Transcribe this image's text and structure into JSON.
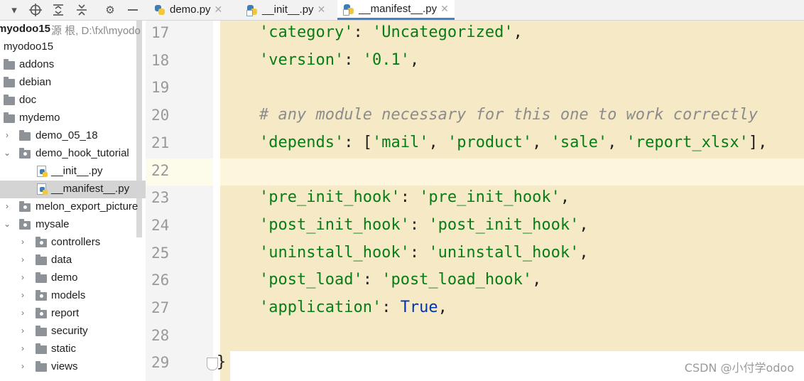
{
  "toolbar": {
    "icons": [
      "chevron-down-icon",
      "crosshair-icon",
      "expand-all-icon",
      "collapse-all-icon",
      "gear-icon",
      "minimize-icon"
    ]
  },
  "tabs": [
    {
      "label": "demo.py",
      "active": false
    },
    {
      "label": "__init__.py",
      "active": false
    },
    {
      "label": "__manifest__.py",
      "active": true
    }
  ],
  "tree": {
    "root_label": "myodoo15",
    "root_hint": "源 根, D:\\fxl\\myodo",
    "items": [
      {
        "label": "myodoo15",
        "type": "text",
        "arrow": ""
      },
      {
        "label": "addons",
        "type": "folder",
        "arrow": ""
      },
      {
        "label": "debian",
        "type": "folder",
        "arrow": ""
      },
      {
        "label": "doc",
        "type": "folder",
        "arrow": ""
      },
      {
        "label": "mydemo",
        "type": "folder",
        "arrow": ""
      },
      {
        "label": "demo_05_18",
        "type": "folder",
        "arrow": ">"
      },
      {
        "label": "demo_hook_tutorial",
        "type": "package",
        "arrow": "v"
      },
      {
        "label": "__init__.py",
        "type": "pyfile",
        "arrow": ""
      },
      {
        "label": "__manifest__.py",
        "type": "pyfile",
        "arrow": "",
        "selected": true
      },
      {
        "label": "melon_export_picture",
        "type": "package",
        "arrow": ">"
      },
      {
        "label": "mysale",
        "type": "package",
        "arrow": "v"
      },
      {
        "label": "controllers",
        "type": "package",
        "arrow": ">"
      },
      {
        "label": "data",
        "type": "folder",
        "arrow": ">"
      },
      {
        "label": "demo",
        "type": "folder",
        "arrow": ">"
      },
      {
        "label": "models",
        "type": "package",
        "arrow": ">"
      },
      {
        "label": "report",
        "type": "package",
        "arrow": ">"
      },
      {
        "label": "security",
        "type": "folder",
        "arrow": ">"
      },
      {
        "label": "static",
        "type": "folder",
        "arrow": ">"
      },
      {
        "label": "views",
        "type": "folder",
        "arrow": ">"
      }
    ]
  },
  "editor": {
    "lines": [
      {
        "n": "17",
        "tokens": [
          {
            "t": "'category'",
            "c": "str"
          },
          {
            "t": ": ",
            "c": ""
          },
          {
            "t": "'Uncategorized'",
            "c": "str"
          },
          {
            "t": ",",
            "c": ""
          }
        ]
      },
      {
        "n": "18",
        "tokens": [
          {
            "t": "'version'",
            "c": "str"
          },
          {
            "t": ": ",
            "c": ""
          },
          {
            "t": "'0.1'",
            "c": "str"
          },
          {
            "t": ",",
            "c": ""
          }
        ]
      },
      {
        "n": "19",
        "tokens": []
      },
      {
        "n": "20",
        "tokens": [
          {
            "t": "# any module necessary for this one to work correctly",
            "c": "com"
          }
        ]
      },
      {
        "n": "21",
        "tokens": [
          {
            "t": "'depends'",
            "c": "str"
          },
          {
            "t": ": [",
            "c": ""
          },
          {
            "t": "'mail'",
            "c": "str"
          },
          {
            "t": ", ",
            "c": ""
          },
          {
            "t": "'product'",
            "c": "str"
          },
          {
            "t": ", ",
            "c": ""
          },
          {
            "t": "'sale'",
            "c": "str"
          },
          {
            "t": ", ",
            "c": ""
          },
          {
            "t": "'report_xlsx'",
            "c": "str"
          },
          {
            "t": "],",
            "c": ""
          }
        ]
      },
      {
        "n": "22",
        "tokens": []
      },
      {
        "n": "23",
        "tokens": [
          {
            "t": "'pre_init_hook'",
            "c": "str"
          },
          {
            "t": ": ",
            "c": ""
          },
          {
            "t": "'pre_init_hook'",
            "c": "str"
          },
          {
            "t": ",",
            "c": ""
          }
        ]
      },
      {
        "n": "24",
        "tokens": [
          {
            "t": "'post_init_hook'",
            "c": "str"
          },
          {
            "t": ": ",
            "c": ""
          },
          {
            "t": "'post_init_hook'",
            "c": "str"
          },
          {
            "t": ",",
            "c": ""
          }
        ]
      },
      {
        "n": "25",
        "tokens": [
          {
            "t": "'uninstall_hook'",
            "c": "str"
          },
          {
            "t": ": ",
            "c": ""
          },
          {
            "t": "'uninstall_hook'",
            "c": "str"
          },
          {
            "t": ",",
            "c": ""
          }
        ]
      },
      {
        "n": "26",
        "tokens": [
          {
            "t": "'post_load'",
            "c": "str"
          },
          {
            "t": ": ",
            "c": ""
          },
          {
            "t": "'post_load_hook'",
            "c": "str"
          },
          {
            "t": ",",
            "c": ""
          }
        ]
      },
      {
        "n": "27",
        "tokens": [
          {
            "t": "'application'",
            "c": "str"
          },
          {
            "t": ": ",
            "c": ""
          },
          {
            "t": "True",
            "c": "kw"
          },
          {
            "t": ",",
            "c": ""
          }
        ]
      },
      {
        "n": "28",
        "tokens": []
      },
      {
        "n": "29",
        "tokens": [
          {
            "t": "}",
            "c": "brace"
          }
        ]
      }
    ]
  },
  "watermark": "CSDN @小付学odoo",
  "colors": {
    "string": "#067d17",
    "comment": "#8c8c8c",
    "keyword": "#0033b3",
    "highlight": "#f5e9c6",
    "tab_accent": "#4083c9"
  }
}
